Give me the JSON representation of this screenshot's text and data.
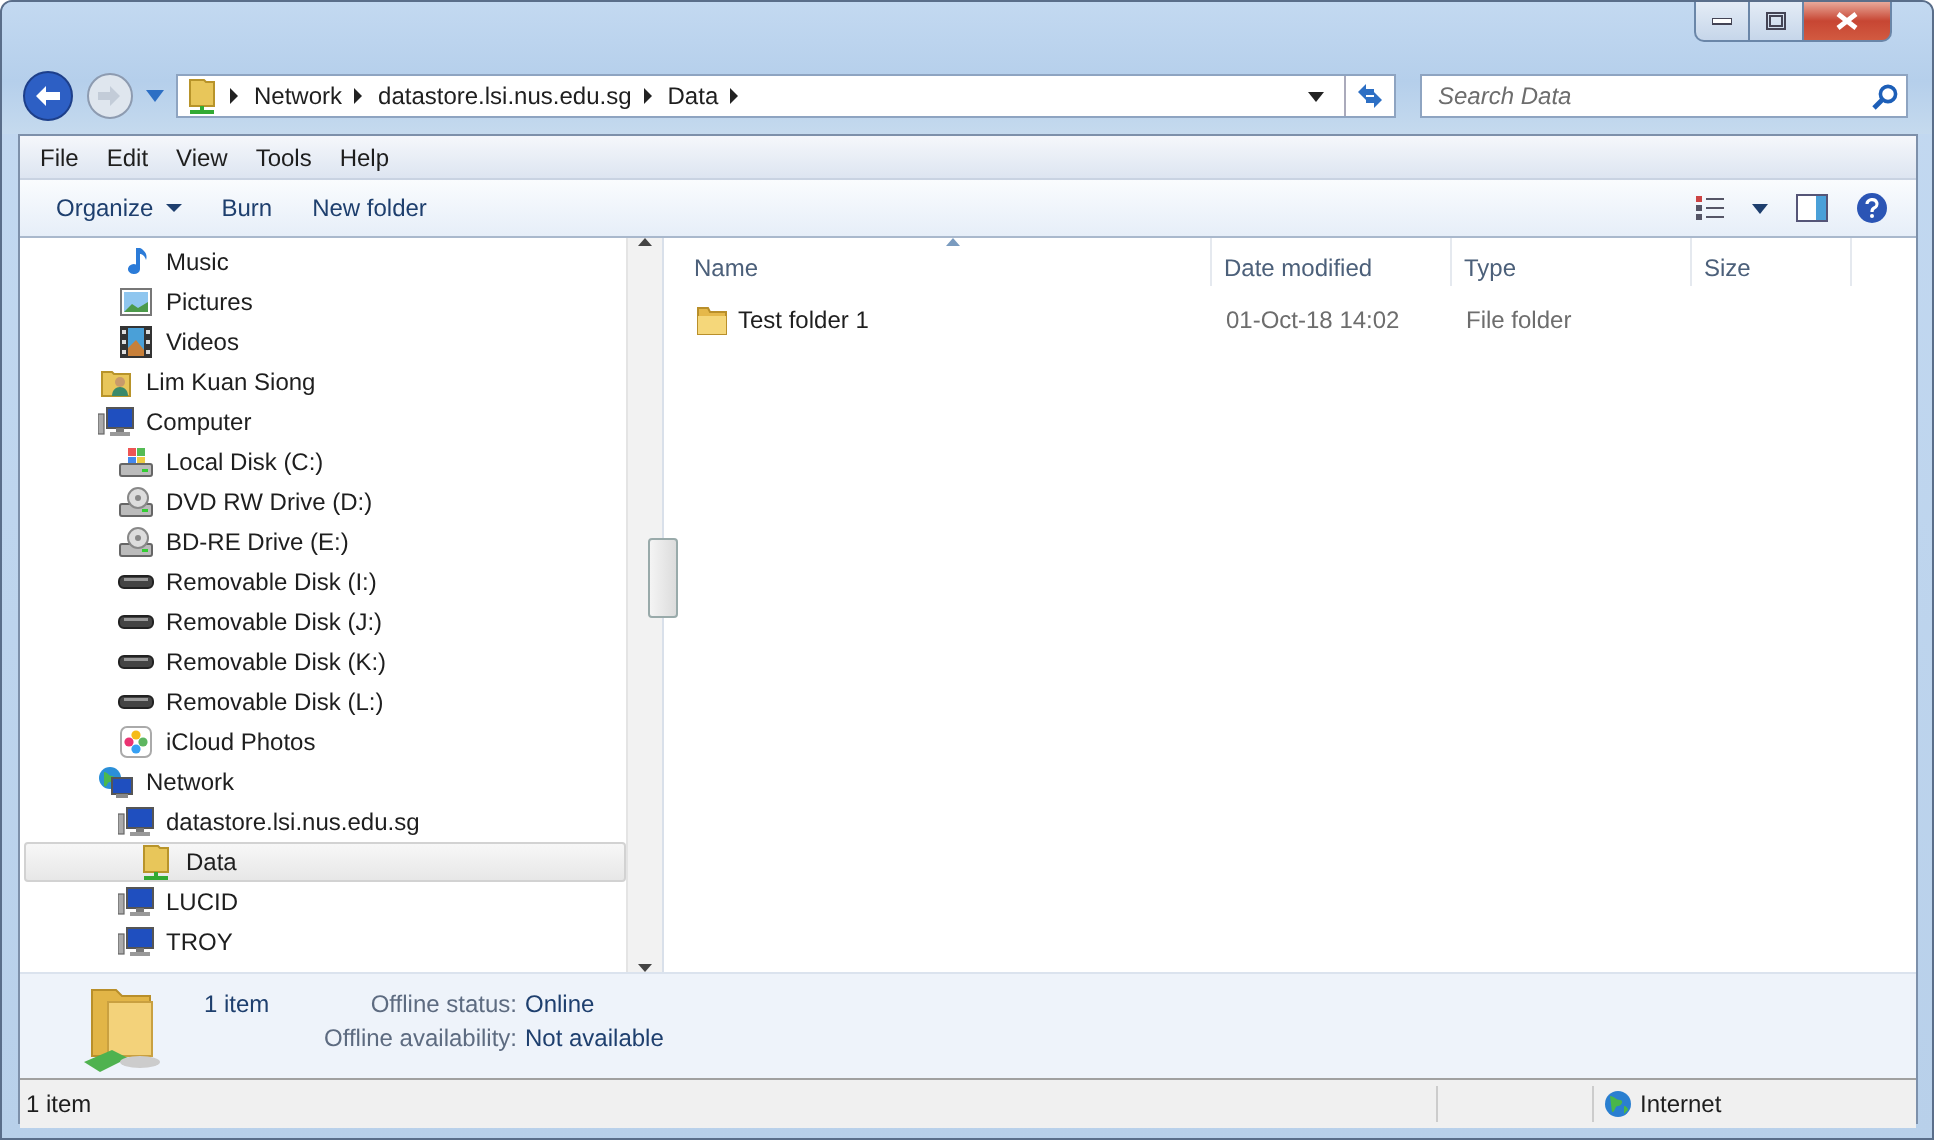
{
  "address_bar": {
    "crumbs": [
      "Network",
      "datastore.lsi.nus.edu.sg",
      "Data"
    ]
  },
  "search": {
    "placeholder": "Search Data"
  },
  "menu": [
    "File",
    "Edit",
    "View",
    "Tools",
    "Help"
  ],
  "toolbar": {
    "buttons": [
      {
        "label": "Organize",
        "dropdown": true
      },
      {
        "label": "Burn",
        "dropdown": false
      },
      {
        "label": "New folder",
        "dropdown": false
      }
    ]
  },
  "sidebar": {
    "continued_items": [
      {
        "label": "Music",
        "kind": "music",
        "selected": false
      },
      {
        "label": "Pictures",
        "kind": "pictures",
        "selected": false
      },
      {
        "label": "Videos",
        "kind": "videos",
        "selected": false
      }
    ],
    "items": [
      {
        "label": "Lim Kuan Siong",
        "kind": "user",
        "selected": false
      },
      {
        "label": "Computer",
        "kind": "computer",
        "selected": false,
        "children": [
          {
            "label": "Local Disk (C:)",
            "kind": "system-disk",
            "selected": false
          },
          {
            "label": "DVD RW Drive (D:)",
            "kind": "optical-drive",
            "selected": false
          },
          {
            "label": "BD-RE Drive (E:)",
            "kind": "optical-drive",
            "selected": false
          },
          {
            "label": "Removable Disk (I:)",
            "kind": "removable-disk",
            "selected": false
          },
          {
            "label": "Removable Disk (J:)",
            "kind": "removable-disk",
            "selected": false
          },
          {
            "label": "Removable Disk (K:)",
            "kind": "removable-disk",
            "selected": false
          },
          {
            "label": "Removable Disk (L:)",
            "kind": "removable-disk",
            "selected": false
          },
          {
            "label": "iCloud Photos",
            "kind": "photos",
            "selected": false
          }
        ]
      },
      {
        "label": "Network",
        "kind": "network",
        "selected": false,
        "children": [
          {
            "label": "datastore.lsi.nus.edu.sg",
            "kind": "server",
            "selected": false,
            "children": [
              {
                "label": "Data",
                "kind": "network-folder",
                "selected": true
              }
            ]
          },
          {
            "label": "LUCID",
            "kind": "server",
            "selected": false
          },
          {
            "label": "TROY",
            "kind": "server",
            "selected": false
          }
        ]
      }
    ]
  },
  "file_list": {
    "columns": [
      {
        "label": "Name",
        "sorted": true
      },
      {
        "label": "Date modified",
        "sorted": false
      },
      {
        "label": "Type",
        "sorted": false
      },
      {
        "label": "Size",
        "sorted": false
      }
    ],
    "rows": [
      {
        "name": "Test folder 1",
        "date_modified": "01-Oct-18 14:02",
        "type": "File folder",
        "selected": false
      }
    ]
  },
  "details": {
    "count": "1 item",
    "properties": [
      {
        "label": "Offline status:",
        "value": "Online"
      },
      {
        "label": "Offline availability:",
        "value": "Not available"
      }
    ]
  },
  "status_bar": {
    "count": "1 item",
    "zone": "Internet"
  }
}
